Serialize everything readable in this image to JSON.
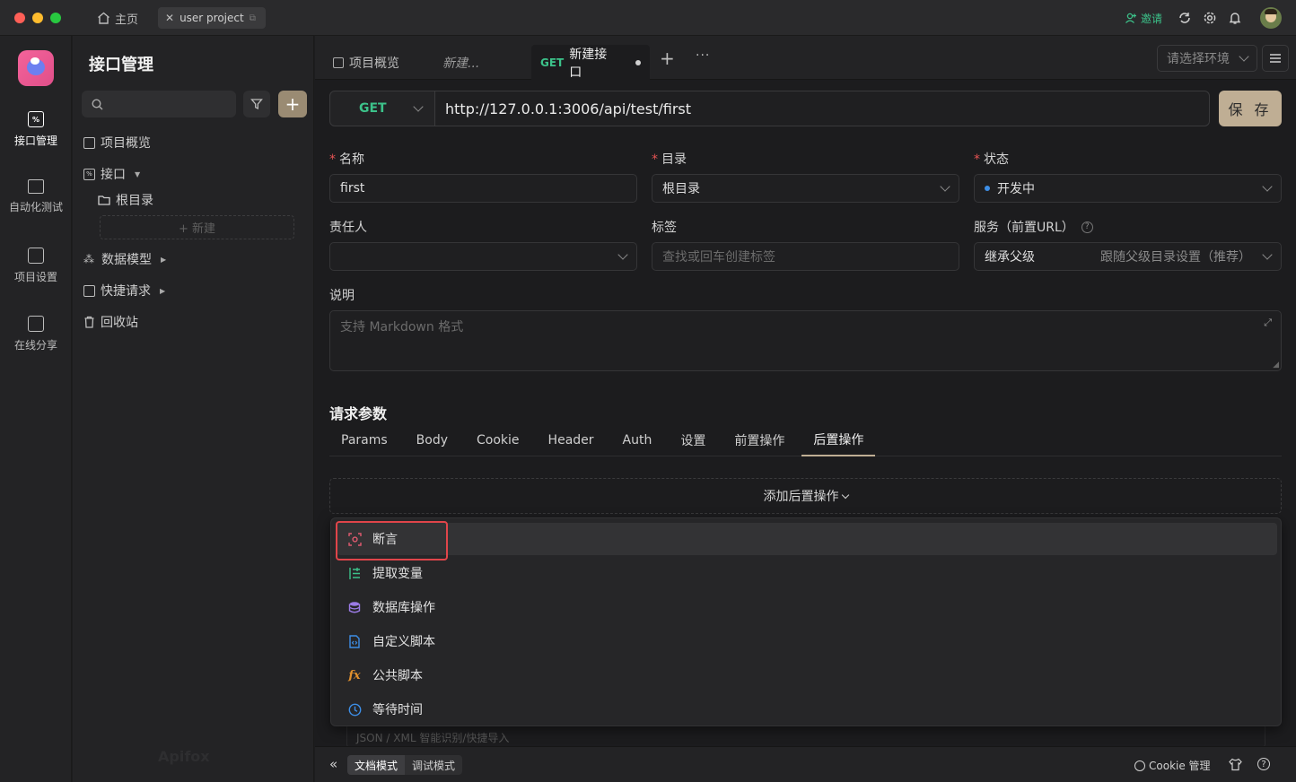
{
  "titlebar": {
    "home_label": "主页",
    "project_tab": "user project",
    "invite_label": "邀请"
  },
  "rail": {
    "items": [
      {
        "label": "接口管理"
      },
      {
        "label": "自动化测试"
      },
      {
        "label": "项目设置"
      },
      {
        "label": "在线分享"
      }
    ]
  },
  "nav": {
    "title": "接口管理",
    "add_label": "+",
    "items": [
      {
        "label": "项目概览"
      },
      {
        "label": "接口"
      },
      {
        "label": "根目录"
      },
      {
        "label": "数据模型"
      },
      {
        "label": "快捷请求"
      },
      {
        "label": "回收站"
      }
    ],
    "new_label": "+ 新建",
    "watermark": "Apifox"
  },
  "tabs": [
    {
      "label": "项目概览"
    },
    {
      "label": "新建..."
    },
    {
      "method": "GET",
      "label": "新建接口"
    }
  ],
  "env_select": {
    "placeholder": "请选择环境"
  },
  "request": {
    "method": "GET",
    "url": "http://127.0.0.1:3006/api/test/first",
    "save_label": "保 存"
  },
  "form": {
    "name_label": "名称",
    "name_value": "first",
    "dir_label": "目录",
    "dir_value": "根目录",
    "status_label": "状态",
    "status_value": "开发中",
    "owner_label": "责任人",
    "tag_label": "标签",
    "tag_placeholder": "查找或回车创建标签",
    "service_label": "服务（前置URL）",
    "service_value": "继承父级",
    "service_hint": "跟随父级目录设置（推荐）",
    "desc_label": "说明",
    "desc_placeholder": "支持 Markdown 格式"
  },
  "params": {
    "section_title": "请求参数",
    "tabs": [
      {
        "label": "Params"
      },
      {
        "label": "Body"
      },
      {
        "label": "Cookie"
      },
      {
        "label": "Header"
      },
      {
        "label": "Auth"
      },
      {
        "label": "设置"
      },
      {
        "label": "前置操作"
      },
      {
        "label": "后置操作"
      }
    ],
    "add_post_label": "添加后置操作",
    "hidden_hint": "JSON / XML 智能识别/快捷导入"
  },
  "dropdown": {
    "items": [
      {
        "label": "断言",
        "icon": "assert-icon",
        "color": "#e05a6f"
      },
      {
        "label": "提取变量",
        "icon": "extract-icon",
        "color": "#3cc28a"
      },
      {
        "label": "数据库操作",
        "icon": "database-icon",
        "color": "#9b7be6"
      },
      {
        "label": "自定义脚本",
        "icon": "script-icon",
        "color": "#3d8ee6"
      },
      {
        "label": "公共脚本",
        "icon": "fx-icon",
        "color": "#e0902d"
      },
      {
        "label": "等待时间",
        "icon": "clock-icon",
        "color": "#3d8ee6"
      }
    ]
  },
  "bottombar": {
    "doc_mode": "文档模式",
    "debug_mode": "调试模式",
    "cookie_label": "Cookie 管理"
  }
}
